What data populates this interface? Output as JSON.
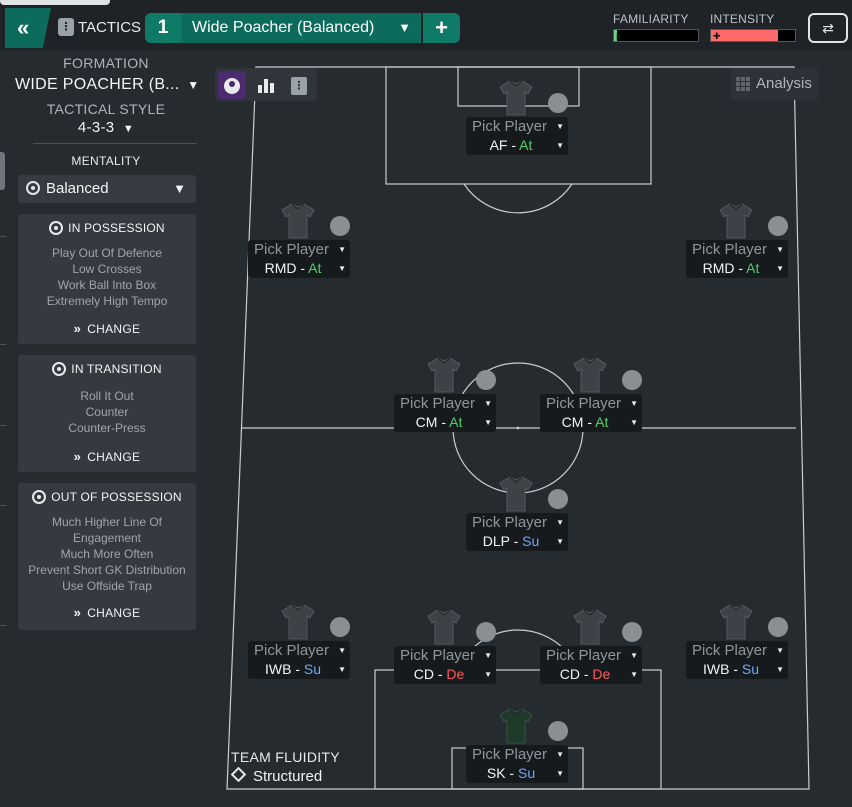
{
  "header": {
    "back_icon_glyph": "«",
    "tactics_label": "TACTICS",
    "tactic_number": "1",
    "tactic_name": "Wide Poacher (Balanced)",
    "add_glyph": "+",
    "familiarity_label": "FAMILIARITY",
    "familiarity_level": 0.04,
    "intensity_label": "INTENSITY",
    "intensity_level": 0.8,
    "swap_glyph": "⇄"
  },
  "colors": {
    "accent": "#0d6b5b",
    "familiarity_fill": "#6fd18f",
    "intensity_fill": "#ff6b6b",
    "attack": "#4fd06a",
    "support": "#6ea7ff",
    "defend": "#ff5a5a",
    "view_active": "#4b2a6d"
  },
  "sidebar": {
    "formation_label": "FORMATION",
    "formation_value": "WIDE POACHER (B...",
    "tactical_style_label": "TACTICAL STYLE",
    "tactical_style_value": "4-3-3",
    "mentality_label": "MENTALITY",
    "mentality_value": "Balanced",
    "in_possession": {
      "title": "IN POSSESSION",
      "items": [
        "Play Out Of Defence",
        "Low Crosses",
        "Work Ball Into Box",
        "Extremely High Tempo"
      ],
      "change_label": "CHANGE"
    },
    "in_transition": {
      "title": "IN TRANSITION",
      "items": [
        "Roll It Out",
        "Counter",
        "Counter-Press"
      ],
      "change_label": "CHANGE"
    },
    "out_of_possession": {
      "title": "OUT OF POSSESSION",
      "items": [
        "Much Higher Line Of",
        "Engagement",
        "Much More Often",
        "Prevent Short GK Distribution",
        "Use Offside Trap"
      ],
      "change_label": "CHANGE"
    }
  },
  "pitch": {
    "analysis_label": "Analysis",
    "pick_label": "Pick Player",
    "team_fluidity_label": "TEAM FLUIDITY",
    "team_fluidity_value": "Structured",
    "positions": [
      {
        "role": "AF",
        "duty": "At",
        "duty_type": "at"
      },
      {
        "role": "RMD",
        "duty": "At",
        "duty_type": "at"
      },
      {
        "role": "RMD",
        "duty": "At",
        "duty_type": "at"
      },
      {
        "role": "CM",
        "duty": "At",
        "duty_type": "at"
      },
      {
        "role": "CM",
        "duty": "At",
        "duty_type": "at"
      },
      {
        "role": "DLP",
        "duty": "Su",
        "duty_type": "su"
      },
      {
        "role": "IWB",
        "duty": "Su",
        "duty_type": "su"
      },
      {
        "role": "CD",
        "duty": "De",
        "duty_type": "de"
      },
      {
        "role": "CD",
        "duty": "De",
        "duty_type": "de"
      },
      {
        "role": "IWB",
        "duty": "Su",
        "duty_type": "su"
      },
      {
        "role": "SK",
        "duty": "Su",
        "duty_type": "su"
      }
    ]
  }
}
